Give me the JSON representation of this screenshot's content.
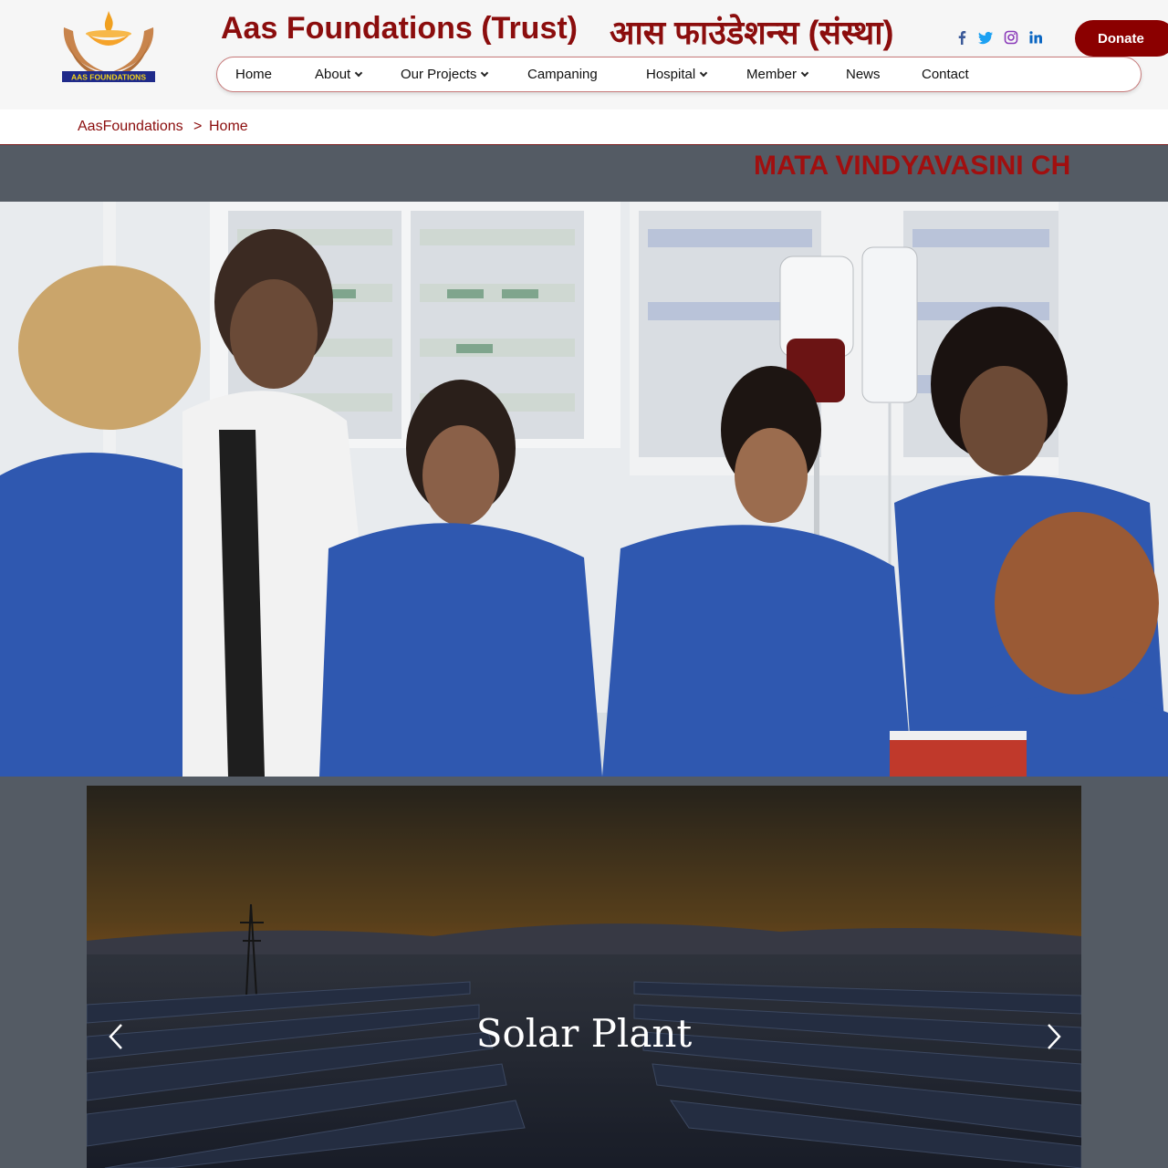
{
  "header": {
    "title_en": "Aas Foundations (Trust)",
    "title_hi": "आस फाउंडेशन्स (संस्था)",
    "logo_text": "AAS FOUNDATIONS",
    "donate_label": "Donate",
    "social": [
      "facebook-icon",
      "twitter-icon",
      "instagram-icon",
      "linkedin-icon"
    ]
  },
  "nav": {
    "items": [
      {
        "label": "Home",
        "dropdown": false
      },
      {
        "label": "About",
        "dropdown": true
      },
      {
        "label": "Our Projects",
        "dropdown": true
      },
      {
        "label": "Campaning",
        "dropdown": false
      },
      {
        "label": "Hospital",
        "dropdown": true
      },
      {
        "label": "Member",
        "dropdown": true
      },
      {
        "label": "News",
        "dropdown": false
      },
      {
        "label": "Contact",
        "dropdown": false
      }
    ]
  },
  "breadcrumb": {
    "root": "AasFoundations",
    "separator": ">",
    "current": "Home"
  },
  "ticker": {
    "text": "MATA VINDYAVASINI CH"
  },
  "slider": {
    "caption": "Solar Plant"
  },
  "colors": {
    "brand": "#8b0d0d",
    "donate_bg": "#8b0000",
    "page_bg": "#545b64"
  }
}
